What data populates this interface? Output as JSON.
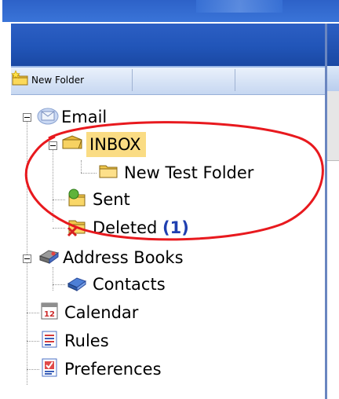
{
  "toolbar": {
    "new_folder_label": "New Folder"
  },
  "tree": {
    "email": "Email",
    "inbox": "INBOX",
    "new_test_folder": "New Test Folder",
    "sent": "Sent",
    "deleted": "Deleted",
    "deleted_count": "(1)",
    "address_books": "Address Books",
    "contacts": "Contacts",
    "calendar": "Calendar",
    "rules": "Rules",
    "preferences": "Preferences"
  },
  "colors": {
    "header_blue": "#2155b8",
    "inbox_highlight": "#fadc84",
    "annotation_red": "#e8191e",
    "count_blue": "#1f3fb0"
  },
  "icons": [
    "new-folder-icon",
    "email-icon",
    "inbox-folder-icon",
    "folder-icon",
    "sent-icon",
    "deleted-icon",
    "address-book-icon",
    "contacts-icon",
    "calendar-icon",
    "rules-icon",
    "preferences-icon"
  ]
}
